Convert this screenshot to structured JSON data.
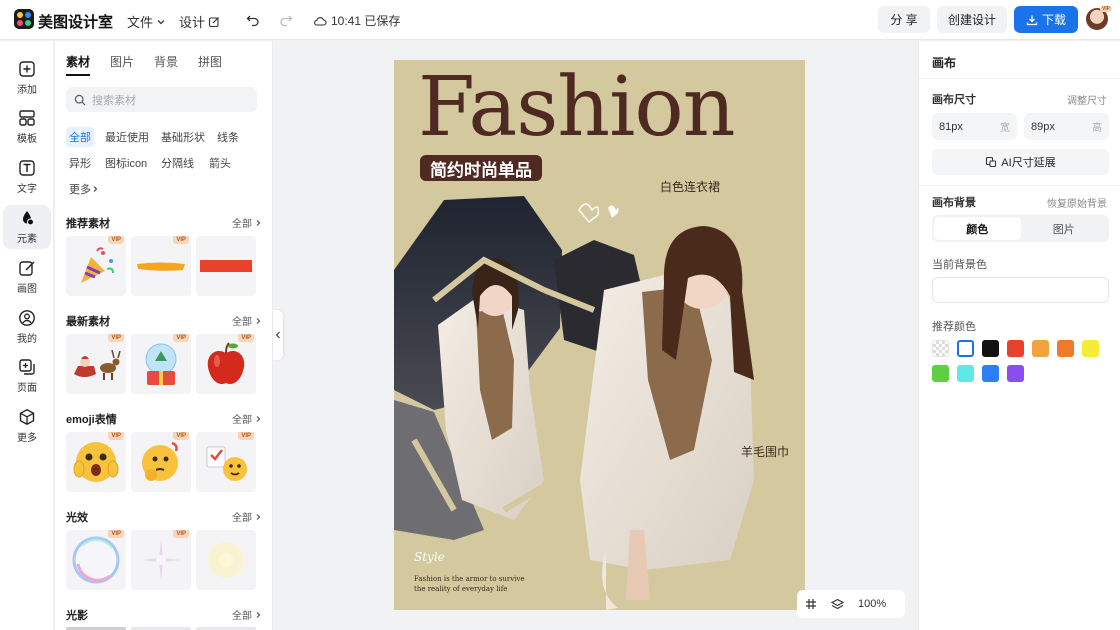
{
  "app": {
    "brand": "美图设计室"
  },
  "topbar": {
    "menu_file": "文件",
    "menu_design": "设计",
    "saved_status": "10:41 已保存",
    "share_label": "分 享",
    "create_label": "创建设计",
    "download_label": "下载"
  },
  "rail": {
    "items": [
      {
        "label": "添加",
        "icon": "plus-square-icon"
      },
      {
        "label": "模板",
        "icon": "template-icon"
      },
      {
        "label": "文字",
        "icon": "text-icon"
      },
      {
        "label": "元素",
        "icon": "shapes-icon"
      },
      {
        "label": "画图",
        "icon": "draw-icon"
      },
      {
        "label": "我的",
        "icon": "user-icon"
      },
      {
        "label": "页面",
        "icon": "page-add-icon"
      },
      {
        "label": "更多",
        "icon": "cube-icon"
      }
    ]
  },
  "panel": {
    "tabs": [
      "素材",
      "图片",
      "背景",
      "拼图"
    ],
    "search_placeholder": "搜索素材",
    "chips": [
      "全部",
      "最近使用",
      "基础形状",
      "线条",
      "异形",
      "图标icon",
      "分隔线",
      "箭头",
      "更多"
    ],
    "see_all": "全部",
    "vip": "VIP",
    "sections": [
      {
        "title": "推荐素材"
      },
      {
        "title": "最新素材"
      },
      {
        "title": "emoji表情"
      },
      {
        "title": "光效"
      },
      {
        "title": "光影"
      }
    ]
  },
  "canvas": {
    "headline": "Fashion",
    "tag": "简约时尚单品",
    "label_dress": "白色连衣裙",
    "label_scarf": "羊毛围巾",
    "script_text": "Style",
    "quote_line1": "Fashion is the armor to survive",
    "quote_line2": "the reality of everyday life",
    "zoom": "100%"
  },
  "right_panel": {
    "title": "画布",
    "size_label": "画布尺寸",
    "adjust_size": "调整尺寸",
    "width_value": "81px",
    "width_unit": "宽",
    "height_value": "89px",
    "height_unit": "高",
    "ai_extend": "AI尺寸延展",
    "bg_label": "画布背景",
    "restore_bg": "恢复原始背景",
    "seg_color": "颜色",
    "seg_image": "图片",
    "current_bg": "当前背景色",
    "recommended": "推荐颜色",
    "colors": [
      "transparent",
      "#ffffff",
      "#111111",
      "#e8412c",
      "#f2a33c",
      "#ee7a2b",
      "#f5ec3a",
      "#5ccf45",
      "#5ee8e8",
      "#2d7ff2",
      "#8b4cf0"
    ]
  }
}
